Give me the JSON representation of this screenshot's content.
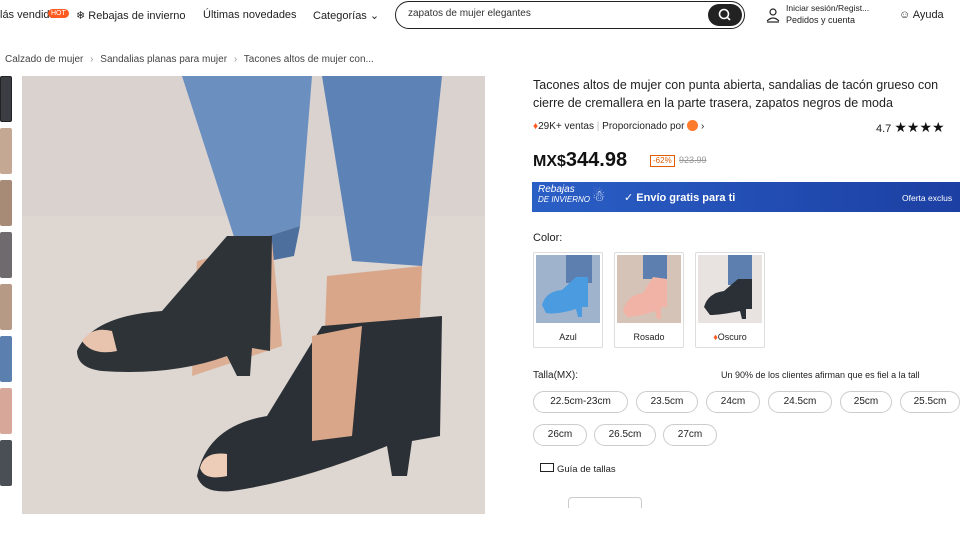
{
  "nav": {
    "best_sellers": "lás vendidos",
    "hot_badge": "HOT",
    "winter_sale": "Rebajas de invierno",
    "new_arrivals": "Últimas novedades",
    "categories": "Categorías",
    "chevron": "⌄"
  },
  "search": {
    "value": "zapatos de mujer elegantes"
  },
  "account": {
    "line1": "Iniciar sesión/Regist...",
    "line2": "Pedidos y cuenta"
  },
  "help": "Ayuda",
  "breadcrumb": [
    "Calzado de mujer",
    "Sandalias planas para mujer",
    "Tacones altos de mujer con..."
  ],
  "product": {
    "title": "Tacones altos de mujer con punta abierta, sandalias de tacón grueso con cierre de cremallera en la parte trasera, zapatos negros de moda",
    "sales": "29K+ ventas",
    "provided_by": "Proporcionado por",
    "rating": "4.7",
    "stars": "★★★★",
    "price_currency": "MX$",
    "price": "344.98",
    "discount": "-62%",
    "original_price": "923.99"
  },
  "banner": {
    "logo_line1": "Rebajas",
    "logo_line2": "DE INVIERNO",
    "text": "✓  Envío gratis para ti",
    "right": "Oferta exclus"
  },
  "colors": {
    "label": "Color:",
    "options": [
      {
        "label": "Azul"
      },
      {
        "label": "Rosado"
      },
      {
        "label": "Oscuro"
      }
    ]
  },
  "sizes": {
    "label": "Talla(MX):",
    "note": "Un 90% de los clientes afirman que es fiel a la tall",
    "options": [
      "22.5cm-23cm",
      "23.5cm",
      "24cm",
      "24.5cm",
      "25cm",
      "25.5cm",
      "26cm",
      "26.5cm",
      "27cm"
    ]
  },
  "size_guide": "Guía de tallas",
  "colors_hex": {
    "accent": "#ff5a1f",
    "banner": "#2a5fc6",
    "price": "#111111"
  }
}
